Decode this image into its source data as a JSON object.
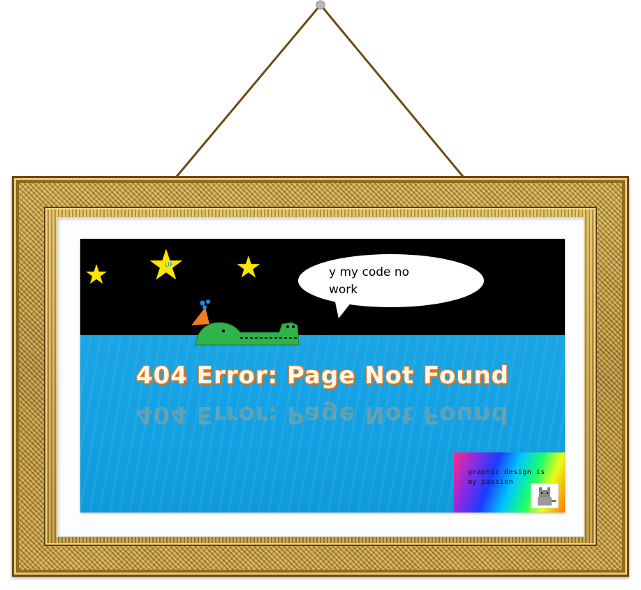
{
  "speech_bubble": {
    "line1": "y my code no",
    "line2": "work"
  },
  "star_label": "UF",
  "error": {
    "title": "404 Error: Page Not Found"
  },
  "badge": {
    "line1": "graphic design is",
    "line2": "my passion"
  },
  "icons": [
    "hanging-nail-icon",
    "star-icon",
    "crocodile-icon",
    "party-hat-icon",
    "cat-icon"
  ],
  "colors": {
    "sky": "#000000",
    "water": "#12a0e2",
    "star": "#ffe600",
    "croc": "#2fb34a",
    "hat": "#f27a1f",
    "title_glow": "#e7730c"
  }
}
